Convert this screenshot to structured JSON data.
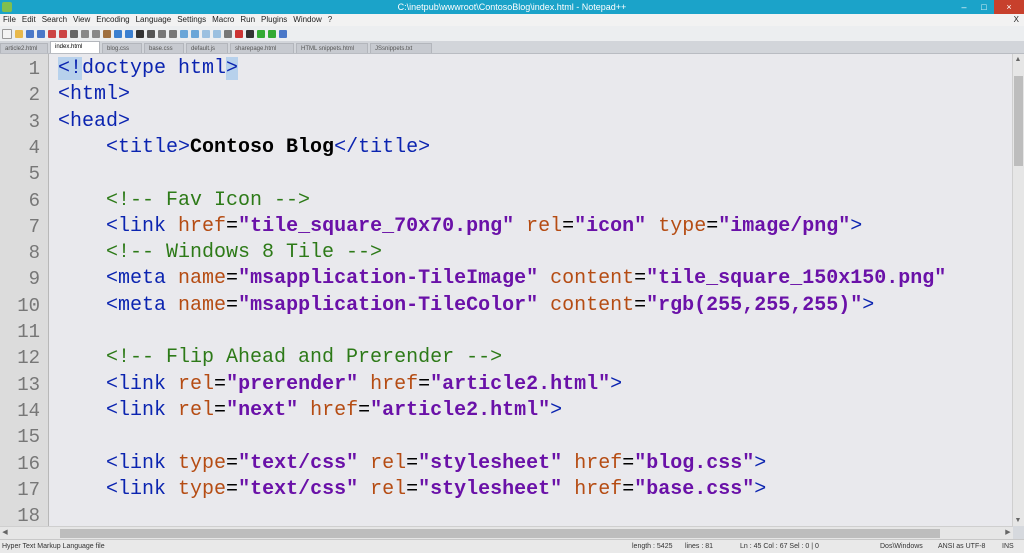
{
  "window": {
    "title": "C:\\inetpub\\wwwroot\\ContosoBlog\\index.html - Notepad++",
    "controls": [
      "–",
      "□",
      "×"
    ]
  },
  "menu": [
    "File",
    "Edit",
    "Search",
    "View",
    "Encoding",
    "Language",
    "Settings",
    "Macro",
    "Run",
    "Plugins",
    "Window",
    "?"
  ],
  "menu_close": "X",
  "tabs": [
    "article2.html",
    "index.html",
    "blog.css",
    "base.css",
    "default.js",
    "sharepage.html",
    "HTML snippets.html",
    "JSsnippets.txt"
  ],
  "active_tab": 1,
  "colors": {
    "titlebar": "#1ba3c9",
    "tag": "#0b24b0",
    "attribute": "#b54c13",
    "string": "#6a11a8",
    "comment": "#2d7a18"
  },
  "editor": {
    "lines": [
      {
        "num": "1",
        "segs": [
          [
            "hl",
            "<!"
          ],
          [
            "t",
            "doctype html"
          ],
          [
            "hl",
            ">"
          ]
        ]
      },
      {
        "num": "2",
        "segs": [
          [
            "t",
            "<html>"
          ]
        ]
      },
      {
        "num": "3",
        "segs": [
          [
            "t",
            "<head>"
          ]
        ]
      },
      {
        "num": "4",
        "segs": [
          [
            "p",
            "    "
          ],
          [
            "t",
            "<title>"
          ],
          [
            "x",
            "Contoso Blog"
          ],
          [
            "t",
            "</title>"
          ]
        ]
      },
      {
        "num": "5",
        "segs": []
      },
      {
        "num": "6",
        "segs": [
          [
            "p",
            "    "
          ],
          [
            "c",
            "<!-- Fav Icon -->"
          ]
        ]
      },
      {
        "num": "7",
        "segs": [
          [
            "p",
            "    "
          ],
          [
            "t",
            "<link "
          ],
          [
            "a",
            "href"
          ],
          [
            "p",
            "="
          ],
          [
            "s",
            "\"tile_square_70x70.png\""
          ],
          [
            "p",
            " "
          ],
          [
            "a",
            "rel"
          ],
          [
            "p",
            "="
          ],
          [
            "s",
            "\"icon\""
          ],
          [
            "p",
            " "
          ],
          [
            "a",
            "type"
          ],
          [
            "p",
            "="
          ],
          [
            "s",
            "\"image/png\""
          ],
          [
            "t",
            ">"
          ]
        ]
      },
      {
        "num": "8",
        "segs": [
          [
            "p",
            "    "
          ],
          [
            "c",
            "<!-- Windows 8 Tile -->"
          ]
        ]
      },
      {
        "num": "9",
        "segs": [
          [
            "p",
            "    "
          ],
          [
            "t",
            "<meta "
          ],
          [
            "a",
            "name"
          ],
          [
            "p",
            "="
          ],
          [
            "s",
            "\"msapplication-TileImage\""
          ],
          [
            "p",
            " "
          ],
          [
            "a",
            "content"
          ],
          [
            "p",
            "="
          ],
          [
            "s",
            "\"tile_square_150x150.png\""
          ]
        ]
      },
      {
        "num": "10",
        "segs": [
          [
            "p",
            "    "
          ],
          [
            "t",
            "<meta "
          ],
          [
            "a",
            "name"
          ],
          [
            "p",
            "="
          ],
          [
            "s",
            "\"msapplication-TileColor\""
          ],
          [
            "p",
            " "
          ],
          [
            "a",
            "content"
          ],
          [
            "p",
            "="
          ],
          [
            "s",
            "\"rgb(255,255,255)\""
          ],
          [
            "t",
            ">"
          ]
        ]
      },
      {
        "num": "11",
        "segs": []
      },
      {
        "num": "12",
        "segs": [
          [
            "p",
            "    "
          ],
          [
            "c",
            "<!-- Flip Ahead and Prerender -->"
          ]
        ]
      },
      {
        "num": "13",
        "segs": [
          [
            "p",
            "    "
          ],
          [
            "t",
            "<link "
          ],
          [
            "a",
            "rel"
          ],
          [
            "p",
            "="
          ],
          [
            "s",
            "\"prerender\""
          ],
          [
            "p",
            " "
          ],
          [
            "a",
            "href"
          ],
          [
            "p",
            "="
          ],
          [
            "s",
            "\"article2.html\""
          ],
          [
            "t",
            ">"
          ]
        ]
      },
      {
        "num": "14",
        "segs": [
          [
            "p",
            "    "
          ],
          [
            "t",
            "<link "
          ],
          [
            "a",
            "rel"
          ],
          [
            "p",
            "="
          ],
          [
            "s",
            "\"next\""
          ],
          [
            "p",
            " "
          ],
          [
            "a",
            "href"
          ],
          [
            "p",
            "="
          ],
          [
            "s",
            "\"article2.html\""
          ],
          [
            "t",
            ">"
          ]
        ]
      },
      {
        "num": "15",
        "segs": []
      },
      {
        "num": "16",
        "segs": [
          [
            "p",
            "    "
          ],
          [
            "t",
            "<link "
          ],
          [
            "a",
            "type"
          ],
          [
            "p",
            "="
          ],
          [
            "s",
            "\"text/css\""
          ],
          [
            "p",
            " "
          ],
          [
            "a",
            "rel"
          ],
          [
            "p",
            "="
          ],
          [
            "s",
            "\"stylesheet\""
          ],
          [
            "p",
            " "
          ],
          [
            "a",
            "href"
          ],
          [
            "p",
            "="
          ],
          [
            "s",
            "\"blog.css\""
          ],
          [
            "t",
            ">"
          ]
        ]
      },
      {
        "num": "17",
        "segs": [
          [
            "p",
            "    "
          ],
          [
            "t",
            "<link "
          ],
          [
            "a",
            "type"
          ],
          [
            "p",
            "="
          ],
          [
            "s",
            "\"text/css\""
          ],
          [
            "p",
            " "
          ],
          [
            "a",
            "rel"
          ],
          [
            "p",
            "="
          ],
          [
            "s",
            "\"stylesheet\""
          ],
          [
            "p",
            " "
          ],
          [
            "a",
            "href"
          ],
          [
            "p",
            "="
          ],
          [
            "s",
            "\"base.css\""
          ],
          [
            "t",
            ">"
          ]
        ]
      },
      {
        "num": "18",
        "segs": []
      }
    ]
  },
  "status": {
    "language": "Hyper Text Markup Language file",
    "length": "length : 5425",
    "lines": "lines : 81",
    "position": "Ln : 45   Col : 67   Sel : 0 | 0",
    "eol": "Dos\\Windows",
    "encoding": "ANSI as UTF-8",
    "mode": "INS"
  }
}
